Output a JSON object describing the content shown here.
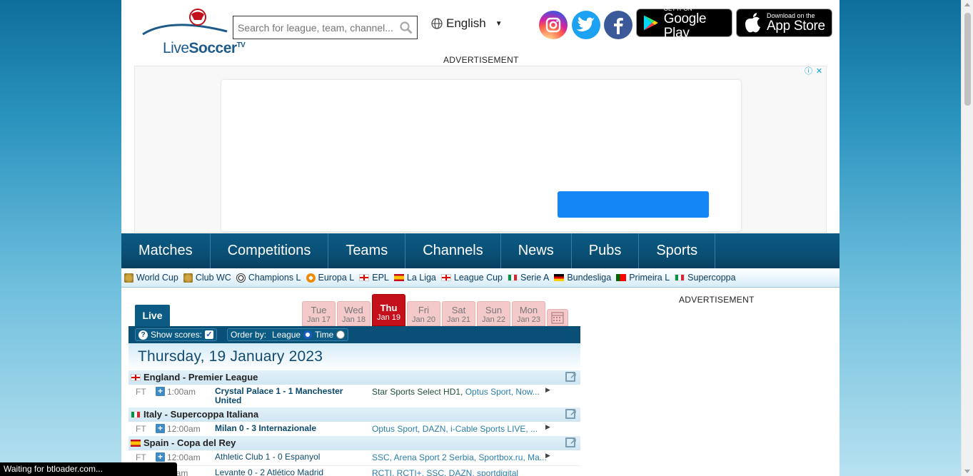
{
  "header": {
    "logo": {
      "line1": "Live",
      "line2": "Soccer",
      "tv": "TV"
    },
    "search": {
      "placeholder": "Search for league, team, channel..."
    },
    "language": {
      "label": "English"
    },
    "stores": {
      "google": {
        "small": "GET IT ON",
        "big": "Google Play"
      },
      "apple": {
        "small": "Download on the",
        "big": "App Store"
      }
    },
    "social_icons": [
      "instagram-icon",
      "twitter-icon",
      "facebook-icon"
    ]
  },
  "ads": {
    "top_label": "ADVERTISEMENT",
    "right_label": "ADVERTISEMENT",
    "close_icons": [
      "info-icon",
      "close-icon"
    ]
  },
  "nav": {
    "items": [
      "Matches",
      "Competitions",
      "Teams",
      "Channels",
      "News",
      "Pubs",
      "Sports"
    ]
  },
  "subnav": {
    "items": [
      {
        "label": "World Cup",
        "icon": "trophy"
      },
      {
        "label": "Club WC",
        "icon": "trophy"
      },
      {
        "label": "Champions L",
        "icon": "ball"
      },
      {
        "label": "Europa L",
        "icon": "el"
      },
      {
        "label": "EPL",
        "icon": "eng"
      },
      {
        "label": "La Liga",
        "icon": "esp"
      },
      {
        "label": "League Cup",
        "icon": "eng"
      },
      {
        "label": "Serie A",
        "icon": "ita"
      },
      {
        "label": "Bundesliga",
        "icon": "ger"
      },
      {
        "label": "Primeira L",
        "icon": "por"
      },
      {
        "label": "Supercoppa",
        "icon": "ita"
      }
    ]
  },
  "schedule": {
    "live_tab": "Live",
    "days": [
      {
        "name": "Tue",
        "date": "Jan 17",
        "active": false
      },
      {
        "name": "Wed",
        "date": "Jan 18",
        "active": false
      },
      {
        "name": "Thu",
        "date": "Jan 19",
        "active": true
      },
      {
        "name": "Fri",
        "date": "Jan 20",
        "active": false
      },
      {
        "name": "Sat",
        "date": "Jan 21",
        "active": false
      },
      {
        "name": "Sun",
        "date": "Jan 22",
        "active": false
      },
      {
        "name": "Mon",
        "date": "Jan 23",
        "active": false
      }
    ],
    "show_scores_label": "Show scores:",
    "show_scores_checked": true,
    "order_by_label": "Order by:",
    "order_options": [
      "League",
      "Time"
    ],
    "order_selected": "League",
    "date_heading": "Thursday, 19 January 2023",
    "leagues": [
      {
        "name": "England - Premier League",
        "flag": "eng"
      },
      {
        "name": "Italy - Supercoppa Italiana",
        "flag": "ita"
      },
      {
        "name": "Spain - Copa del Rey",
        "flag": "esp"
      }
    ],
    "matches": [
      {
        "status": "FT",
        "time": "1:00am",
        "teams": "Crystal Palace 1 - 1 Manchester United",
        "bold": true,
        "channels_plain": "Star Sports Select HD1, ",
        "channels": "Optus Sport, Now..."
      },
      {
        "status": "FT",
        "time": "12:00am",
        "teams": "Milan 0 - 3 Internazionale",
        "bold": true,
        "channels_plain": "",
        "channels": "Optus Sport, DAZN, i-Cable Sports LIVE, ..."
      },
      {
        "status": "FT",
        "time": "12:00am",
        "teams": "Athletic Club 1 - 0 Espanyol",
        "bold": false,
        "channels_plain": "",
        "channels": "SSC, Arena Sport 2 Serbia, Sportbox.ru, Ma..."
      },
      {
        "status": "",
        "time": "0am",
        "teams": "Levante 0 - 2 Atlético Madrid",
        "bold": false,
        "channels_plain": "",
        "channels": "RCTI, RCTI+, SSC, DAZN, sportdigital"
      }
    ]
  },
  "browser_status": "Waiting for btloader.com..."
}
